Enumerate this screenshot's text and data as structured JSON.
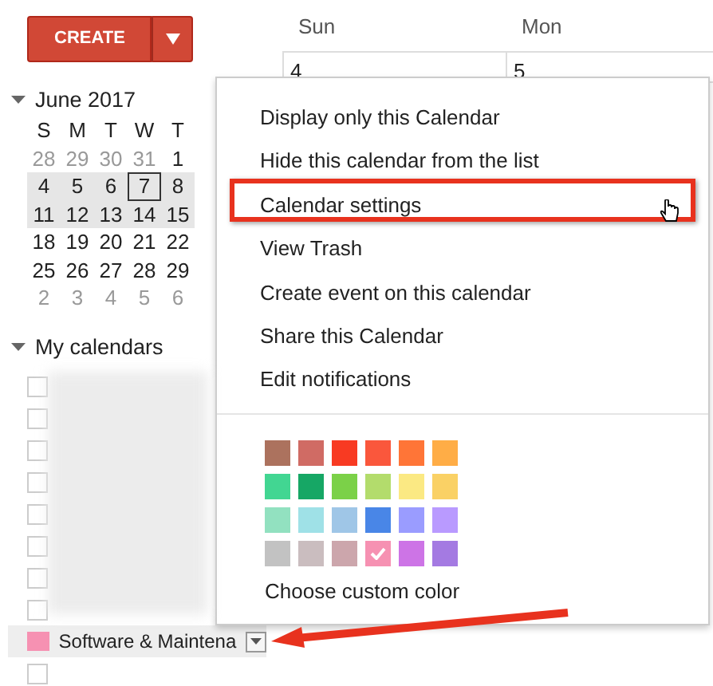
{
  "create_button": {
    "label": "CREATE"
  },
  "mini_calendar": {
    "title": "June 2017",
    "expanded": true,
    "weekdays": [
      "S",
      "M",
      "T",
      "W",
      "T"
    ],
    "weeks": [
      {
        "highlighted": false,
        "days": [
          {
            "label": "28",
            "muted": true,
            "selected": false
          },
          {
            "label": "29",
            "muted": true,
            "selected": false
          },
          {
            "label": "30",
            "muted": true,
            "selected": false
          },
          {
            "label": "31",
            "muted": true,
            "selected": false
          },
          {
            "label": "1",
            "muted": false,
            "selected": false
          }
        ]
      },
      {
        "highlighted": true,
        "days": [
          {
            "label": "4",
            "muted": false,
            "selected": false
          },
          {
            "label": "5",
            "muted": false,
            "selected": false
          },
          {
            "label": "6",
            "muted": false,
            "selected": false
          },
          {
            "label": "7",
            "muted": false,
            "selected": true
          },
          {
            "label": "8",
            "muted": false,
            "selected": false
          }
        ]
      },
      {
        "highlighted": true,
        "days": [
          {
            "label": "11",
            "muted": false,
            "selected": false
          },
          {
            "label": "12",
            "muted": false,
            "selected": false
          },
          {
            "label": "13",
            "muted": false,
            "selected": false
          },
          {
            "label": "14",
            "muted": false,
            "selected": false
          },
          {
            "label": "15",
            "muted": false,
            "selected": false
          }
        ]
      },
      {
        "highlighted": false,
        "days": [
          {
            "label": "18",
            "muted": false,
            "selected": false
          },
          {
            "label": "19",
            "muted": false,
            "selected": false
          },
          {
            "label": "20",
            "muted": false,
            "selected": false
          },
          {
            "label": "21",
            "muted": false,
            "selected": false
          },
          {
            "label": "22",
            "muted": false,
            "selected": false
          }
        ]
      },
      {
        "highlighted": false,
        "days": [
          {
            "label": "25",
            "muted": false,
            "selected": false
          },
          {
            "label": "26",
            "muted": false,
            "selected": false
          },
          {
            "label": "27",
            "muted": false,
            "selected": false
          },
          {
            "label": "28",
            "muted": false,
            "selected": false
          },
          {
            "label": "29",
            "muted": false,
            "selected": false
          }
        ]
      },
      {
        "highlighted": false,
        "days": [
          {
            "label": "2",
            "muted": true,
            "selected": false
          },
          {
            "label": "3",
            "muted": true,
            "selected": false
          },
          {
            "label": "4",
            "muted": true,
            "selected": false
          },
          {
            "label": "5",
            "muted": true,
            "selected": false
          },
          {
            "label": "6",
            "muted": true,
            "selected": false
          }
        ]
      }
    ]
  },
  "my_calendars": {
    "title": "My calendars",
    "expanded": true,
    "items": [
      {
        "kind": "redacted",
        "checked": false
      },
      {
        "kind": "redacted",
        "checked": false
      },
      {
        "kind": "redacted",
        "checked": false
      },
      {
        "kind": "redacted",
        "checked": false
      },
      {
        "kind": "redacted",
        "checked": false
      },
      {
        "kind": "redacted",
        "checked": false
      },
      {
        "kind": "redacted",
        "checked": false
      },
      {
        "kind": "redacted",
        "checked": false
      },
      {
        "kind": "calendar",
        "name": "Software & Maintena",
        "color": "#f691b2",
        "selected": true
      },
      {
        "kind": "redacted",
        "checked": false
      }
    ]
  },
  "main_grid": {
    "columns": [
      "Sun",
      "Mon"
    ],
    "dates": [
      "4",
      "5"
    ]
  },
  "menu": {
    "items": [
      {
        "label": "Display only this Calendar",
        "annotated": false
      },
      {
        "label": "Hide this calendar from the list",
        "annotated": false
      },
      {
        "label": "Calendar settings",
        "annotated": true
      },
      {
        "label": "View Trash",
        "annotated": false
      },
      {
        "label": "Create event on this calendar",
        "annotated": false
      },
      {
        "label": "Share this Calendar",
        "annotated": false
      },
      {
        "label": "Edit notifications",
        "annotated": false
      }
    ],
    "palette": [
      {
        "color": "#ac725e",
        "selected": false
      },
      {
        "color": "#d06b64",
        "selected": false
      },
      {
        "color": "#f83a22",
        "selected": false
      },
      {
        "color": "#fa573c",
        "selected": false
      },
      {
        "color": "#ff7537",
        "selected": false
      },
      {
        "color": "#ffad46",
        "selected": false
      },
      {
        "color": "#42d692",
        "selected": false
      },
      {
        "color": "#16a765",
        "selected": false
      },
      {
        "color": "#7bd148",
        "selected": false
      },
      {
        "color": "#b3dc6c",
        "selected": false
      },
      {
        "color": "#fbe983",
        "selected": false
      },
      {
        "color": "#fad165",
        "selected": false
      },
      {
        "color": "#92e1c0",
        "selected": false
      },
      {
        "color": "#9fe1e7",
        "selected": false
      },
      {
        "color": "#9fc6e7",
        "selected": false
      },
      {
        "color": "#4986e7",
        "selected": false
      },
      {
        "color": "#9a9cff",
        "selected": false
      },
      {
        "color": "#b99aff",
        "selected": false
      },
      {
        "color": "#c2c2c2",
        "selected": false
      },
      {
        "color": "#cabdbf",
        "selected": false
      },
      {
        "color": "#cca6ac",
        "selected": false
      },
      {
        "color": "#f691b2",
        "selected": true
      },
      {
        "color": "#cd74e6",
        "selected": false
      },
      {
        "color": "#a47ae2",
        "selected": false
      }
    ],
    "custom_color": "Choose custom color"
  }
}
